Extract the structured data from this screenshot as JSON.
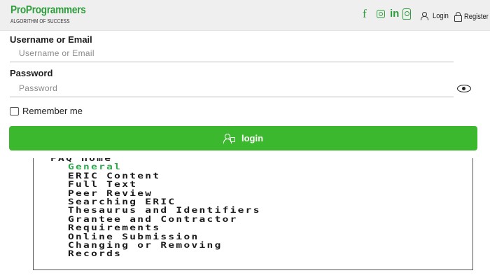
{
  "brand": {
    "name": "ProProgrammers",
    "tagline": "ALGORITHM OF SUCCESS",
    "color": "#2e9c3d"
  },
  "header": {
    "social_icons": [
      "facebook-icon",
      "instagram-icon",
      "linkedin-icon",
      "external-icon"
    ],
    "login_label": "Login",
    "register_label": "Register"
  },
  "form": {
    "username": {
      "label": "Username or Email",
      "placeholder": "Username or Email",
      "value": ""
    },
    "password": {
      "label": "Password",
      "placeholder": "Password",
      "value": ""
    },
    "remember_label": "Remember me",
    "remember_checked": false,
    "submit_label": "login",
    "submit_color": "#3cb82f"
  },
  "faq": {
    "items": [
      {
        "label": "FAQ Home",
        "level": 0,
        "active": false
      },
      {
        "label": "General",
        "level": 1,
        "active": true
      },
      {
        "label": "ERIC Content",
        "level": 1,
        "active": false
      },
      {
        "label": "Full Text",
        "level": 1,
        "active": false
      },
      {
        "label": "Peer Review",
        "level": 1,
        "active": false
      },
      {
        "label": "Searching ERIC",
        "level": 1,
        "active": false
      },
      {
        "label": "Thesaurus and Identifiers",
        "level": 1,
        "active": false
      },
      {
        "label": "Grantee and Contractor",
        "level": 1,
        "active": false
      },
      {
        "label": "Requirements",
        "level": 1,
        "active": false
      },
      {
        "label": "Online Submission",
        "level": 1,
        "active": false
      },
      {
        "label": "Changing or Removing",
        "level": 1,
        "active": false
      },
      {
        "label": "Records",
        "level": 1,
        "active": false
      }
    ],
    "active_color": "#2fa84f"
  }
}
